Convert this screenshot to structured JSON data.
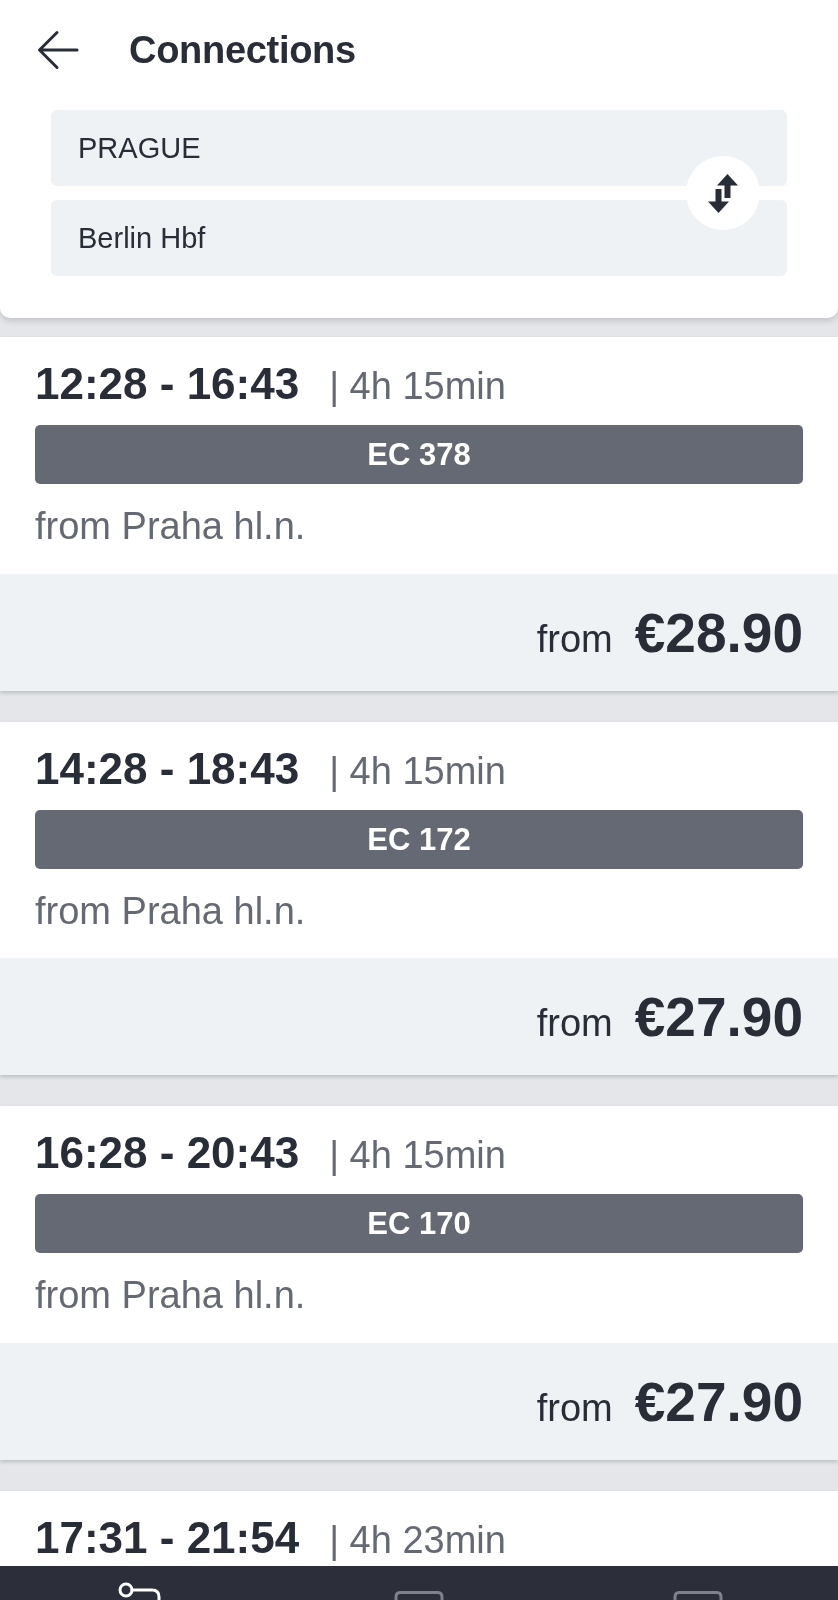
{
  "header": {
    "title": "Connections"
  },
  "search": {
    "origin": "PRAGUE",
    "destination": "Berlin Hbf"
  },
  "connections": [
    {
      "times": "12:28 - 16:43",
      "duration": "| 4h 15min",
      "train": "EC 378",
      "origin": "from Praha hl.n.",
      "price_prefix": "from",
      "price": "€28.90"
    },
    {
      "times": "14:28 - 18:43",
      "duration": "| 4h 15min",
      "train": "EC 172",
      "origin": "from Praha hl.n.",
      "price_prefix": "from",
      "price": "€27.90"
    },
    {
      "times": "16:28 - 20:43",
      "duration": "| 4h 15min",
      "train": "EC 170",
      "origin": "from Praha hl.n.",
      "price_prefix": "from",
      "price": "€27.90"
    },
    {
      "times": "17:31 - 21:54",
      "duration": "| 4h 23min"
    }
  ],
  "bottom_nav": [
    {
      "kind": "route",
      "selected": true
    },
    {
      "kind": "tile",
      "selected": false
    },
    {
      "kind": "tile",
      "selected": false
    }
  ]
}
